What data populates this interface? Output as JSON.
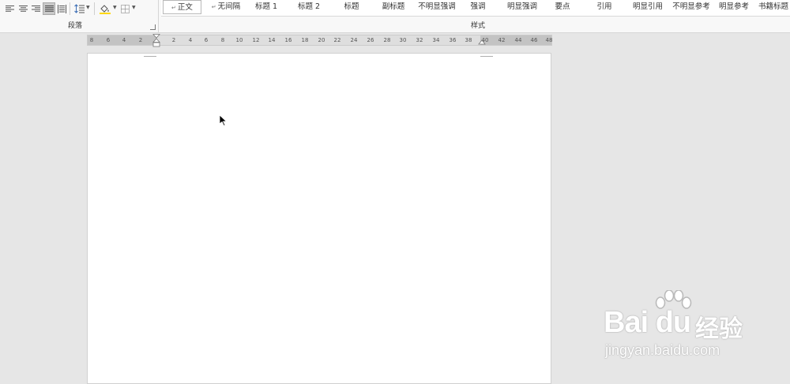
{
  "ribbon": {
    "paragraph_group": {
      "label": "段落",
      "buttons": [
        "align-left",
        "align-center",
        "align-right",
        "justify",
        "distributed",
        "line-spacing",
        "shading",
        "borders"
      ],
      "selected": "justify"
    },
    "styles_group": {
      "label": "样式",
      "selected": "正文",
      "items": [
        "正文",
        "无间隔",
        "标题 1",
        "标题 2",
        "标题",
        "副标题",
        "不明显强调",
        "强调",
        "明显强调",
        "要点",
        "引用",
        "明显引用",
        "不明显参考",
        "明显参考",
        "书籍标题"
      ]
    }
  },
  "ruler": {
    "left_numbers": [
      "8",
      "6",
      "4",
      "2"
    ],
    "right_numbers": [
      "2",
      "4",
      "6",
      "8",
      "10",
      "12",
      "14",
      "16",
      "18",
      "20",
      "22",
      "24",
      "26",
      "28",
      "30",
      "32",
      "34",
      "36",
      "38",
      "40",
      "42",
      "44",
      "46",
      "48"
    ]
  },
  "watermark": {
    "brand": "Bai du",
    "product": "经验",
    "url": "jingyan.baidu.com"
  },
  "colors": {
    "background": "#e6e6e6",
    "ribbon": "#f8f8f8",
    "page": "#ffffff"
  }
}
